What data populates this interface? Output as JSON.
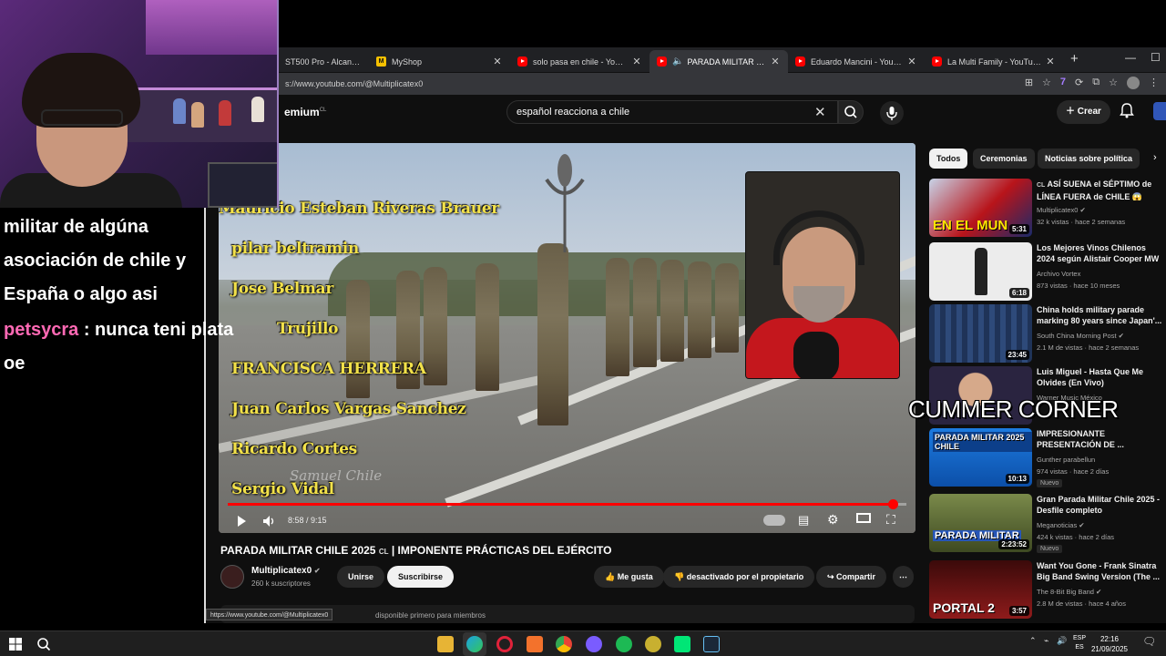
{
  "browser": {
    "tabs": [
      {
        "label": "ST500 Pro - Alcantara",
        "active": false
      },
      {
        "label": "MyShop",
        "active": false
      },
      {
        "label": "solo pasa en chile - YouTube",
        "active": false
      },
      {
        "label": "PARADA MILITAR CHILE 20",
        "active": true
      },
      {
        "label": "Eduardo Mancini - YouTube",
        "active": false
      },
      {
        "label": "La Multi Family - YouTube",
        "active": false
      }
    ],
    "url": "s://www.youtube.com/@Multiplicatex0",
    "status_url": "https://www.youtube.com/@Multiplicatex0"
  },
  "youtube": {
    "logo": "emium",
    "logo_region": "CL",
    "search_query": "español reacciona a chile",
    "create_label": "Crear",
    "video": {
      "title": "PARADA MILITAR CHILE 2025",
      "title_flag": "CL",
      "title_rest": "| IMPONENTE PRÁCTICAS DEL EJÉRCITO",
      "time": "8:58 / 9:15",
      "progress": 0.9797,
      "overlay_names": [
        "Mauricio Esteban Riveras Brauer",
        "pilar beltramin",
        "Jose Belmar",
        "Trujillo",
        "FRANCISCA HERRERA",
        "Juan Carlos Vargas Sanchez",
        "Ricardo Cortes",
        "Sergio Vidal"
      ],
      "watermark": "Samuel Chile"
    },
    "channel": {
      "name": "Multiplicatex0",
      "subs": "260 k suscriptores"
    },
    "actions": {
      "join": "Unirse",
      "subscribe": "Suscribirse",
      "like": "Me gusta",
      "dislike": "desactivado por el propietario",
      "share": "Compartir"
    },
    "comment_hint": "disponible primero para miembros",
    "chips": [
      "Todos",
      "Ceremonias",
      "Noticias sobre política"
    ],
    "recommendations": [
      {
        "title": "ASÍ SUENA el SÉPTIMO de LÍNEA FUERA de CHILE 😱",
        "title_flag": "CL",
        "channel": "Multiplicatex0",
        "meta": "32 k vistas · hace 2 semanas",
        "duration": "5:31",
        "thumb_text": "EN EL MUN",
        "thumb_color": "#b8141a",
        "badge": ""
      },
      {
        "title": "Los Mejores Vinos Chilenos 2024 según Alistair Cooper MW",
        "channel": "Archivo Vortex",
        "meta": "873 vistas · hace 10 meses",
        "duration": "6:18",
        "thumb_text": "",
        "thumb_color": "#e8e8e8",
        "badge": ""
      },
      {
        "title": "China holds military parade marking 80 years since Japan'...",
        "channel": "South China Morning Post",
        "meta": "2.1 M de vistas · hace 2 semanas",
        "duration": "23:45",
        "thumb_text": "",
        "thumb_color": "#2a3f66",
        "badge": ""
      },
      {
        "title": "Luis Miguel - Hasta Que Me Olvides (En Vivo)",
        "channel": "Warner Music México",
        "meta": "",
        "duration": "",
        "thumb_text": "",
        "thumb_color": "#1a1a2e",
        "badge": ""
      },
      {
        "title": "IMPRESIONANTE PRESENTACIÓN DE ...",
        "channel": "Gunther parabellun",
        "meta": "974 vistas · hace 2 días",
        "duration": "10:13",
        "thumb_text": "PARADA MILITAR 2025 CHILE",
        "thumb_color": "#1763c9",
        "badge": "Nuevo"
      },
      {
        "title": "Gran Parada Militar Chile 2025 - Desfile completo",
        "channel": "Meganoticias",
        "meta": "424 k vistas · hace 2 días",
        "duration": "2:23:52",
        "thumb_text": "PARADA MILITAR",
        "thumb_color": "#4e5b2e",
        "badge": "Nuevo"
      },
      {
        "title": "Want You Gone - Frank Sinatra Big Band Swing Version (The ...",
        "channel": "The 8-Bit Big Band",
        "meta": "2.8 M de vistas · hace 4 años",
        "duration": "3:57",
        "thumb_text": "PORTAL 2",
        "thumb_color": "#7a1414",
        "badge": ""
      }
    ]
  },
  "stream_overlay": {
    "corner_text": "CUMMER CORNER",
    "chat": [
      {
        "user": "",
        "text": "militar de algúna"
      },
      {
        "user": "",
        "text": "asociación de chile y"
      },
      {
        "user": "",
        "text": "España o algo asi"
      },
      {
        "user": "petsycra",
        "text": ": nunca teni plata"
      },
      {
        "user": "",
        "text": "oe"
      }
    ]
  },
  "taskbar": {
    "lang_top": "ESP",
    "lang_bottom": "ES",
    "time": "22:16",
    "date": "21/09/2025"
  }
}
